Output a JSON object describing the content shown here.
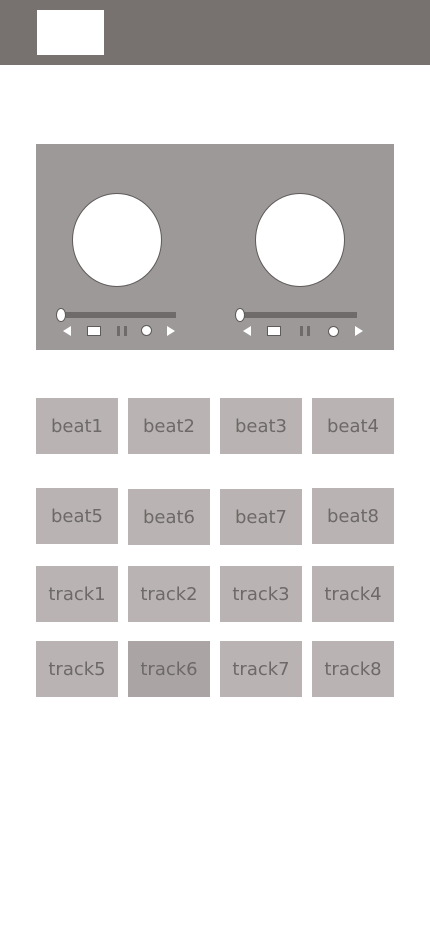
{
  "colors": {
    "header_bg": "#77716f",
    "deck_bg": "#9d9998",
    "pad_bg": "#b9b4b3",
    "pad_active_bg": "#aaa5a4",
    "pad_text": "#6d6968"
  },
  "deck": {
    "left": {
      "controls": [
        "previous-icon",
        "stop-icon",
        "pause-icon",
        "record-icon",
        "play-icon"
      ]
    },
    "right": {
      "controls": [
        "previous-icon",
        "stop-icon",
        "pause-icon",
        "record-icon",
        "play-icon"
      ]
    }
  },
  "beats": [
    {
      "label": "beat1"
    },
    {
      "label": "beat2"
    },
    {
      "label": "beat3"
    },
    {
      "label": "beat4"
    },
    {
      "label": "beat5"
    },
    {
      "label": "beat6"
    },
    {
      "label": "beat7"
    },
    {
      "label": "beat8"
    }
  ],
  "tracks": [
    {
      "label": "track1"
    },
    {
      "label": "track2"
    },
    {
      "label": "track3"
    },
    {
      "label": "track4"
    },
    {
      "label": "track5"
    },
    {
      "label": "track6",
      "active": true
    },
    {
      "label": "track7"
    },
    {
      "label": "track8"
    }
  ]
}
